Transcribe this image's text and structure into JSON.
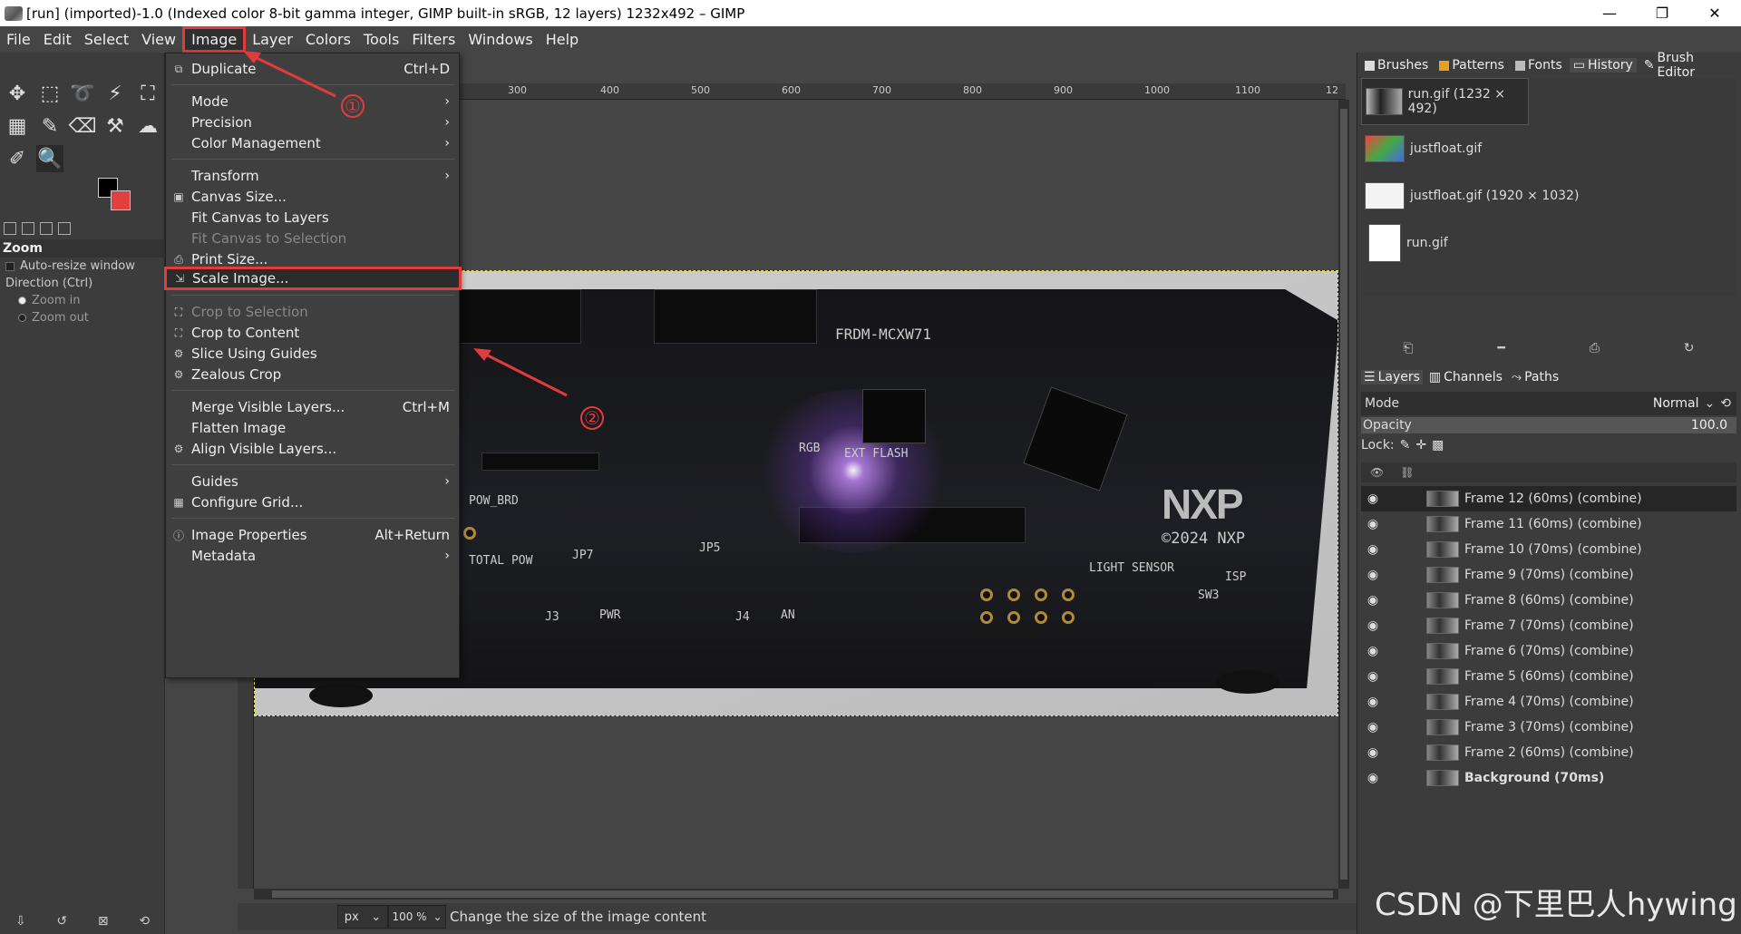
{
  "window": {
    "title": "[run] (imported)-1.0 (Indexed color 8-bit gamma integer, GIMP built-in sRGB, 12 layers) 1232x492 – GIMP",
    "minimize": "—",
    "maximize": "❐",
    "close": "✕"
  },
  "menubar": [
    "File",
    "Edit",
    "Select",
    "View",
    "Image",
    "Layer",
    "Colors",
    "Tools",
    "Filters",
    "Windows",
    "Help"
  ],
  "image_menu": {
    "duplicate": {
      "label": "Duplicate",
      "shortcut": "Ctrl+D"
    },
    "mode": "Mode",
    "precision": "Precision",
    "color_management": "Color Management",
    "transform": "Transform",
    "canvas_size": "Canvas Size...",
    "fit_canvas_layers": "Fit Canvas to Layers",
    "fit_canvas_selection": "Fit Canvas to Selection",
    "print_size": "Print Size...",
    "scale_image": "Scale Image...",
    "crop_selection": "Crop to Selection",
    "crop_content": "Crop to Content",
    "slice_guides": "Slice Using Guides",
    "zealous_crop": "Zealous Crop",
    "merge_visible": {
      "label": "Merge Visible Layers...",
      "shortcut": "Ctrl+M"
    },
    "flatten": "Flatten Image",
    "align_visible": "Align Visible Layers...",
    "guides": "Guides",
    "configure_grid": "Configure Grid...",
    "image_properties": {
      "label": "Image Properties",
      "shortcut": "Alt+Return"
    },
    "metadata": "Metadata"
  },
  "annotations": {
    "step1": "①",
    "step2": "②"
  },
  "tool_options": {
    "title": "Zoom",
    "auto_resize": "Auto-resize window",
    "direction": "Direction  (Ctrl)",
    "zoom_in": "Zoom in",
    "zoom_out": "Zoom out"
  },
  "ruler_marks": [
    "300",
    "400",
    "500",
    "600",
    "700",
    "800",
    "900",
    "1000",
    "1100",
    "12"
  ],
  "pcb_labels": {
    "board_name": "FRDM-MCXW71",
    "logo": "NXP",
    "copyright": "©2024 NXP",
    "rgb": "RGB",
    "ext_flash": "EXT FLASH",
    "light_sensor": "LIGHT SENSOR",
    "pow_brd": "POW_BRD",
    "total_pow": "TOTAL POW",
    "pwr": "PWR",
    "an": "AN",
    "j3": "J3",
    "j4": "J4",
    "jp7": "JP7",
    "jp5": "JP5",
    "sw3": "SW3",
    "isp": "ISP"
  },
  "dock": {
    "tabs": [
      "Brushes",
      "Patterns",
      "Fonts",
      "History",
      "Brush Editor"
    ],
    "images": [
      {
        "name": "run.gif (1232 × 492)"
      },
      {
        "name": "justfloat.gif"
      },
      {
        "name": "justfloat.gif (1920 × 1032)"
      },
      {
        "name": "run.gif"
      }
    ],
    "layers_tabs": [
      "Layers",
      "Channels",
      "Paths"
    ],
    "mode_label": "Mode",
    "mode_value": "Normal",
    "opacity_label": "Opacity",
    "opacity_value": "100.0",
    "lock_label": "Lock:",
    "layers": [
      "Frame 12 (60ms) (combine)",
      "Frame 11 (60ms) (combine)",
      "Frame 10 (70ms) (combine)",
      "Frame 9 (70ms) (combine)",
      "Frame 8 (60ms) (combine)",
      "Frame 7 (70ms) (combine)",
      "Frame 6 (70ms) (combine)",
      "Frame 5 (60ms) (combine)",
      "Frame 4 (70ms) (combine)",
      "Frame 3 (70ms) (combine)",
      "Frame 2 (60ms) (combine)",
      "Background (70ms)"
    ]
  },
  "statusbar": {
    "unit": "px",
    "zoom": "100 %",
    "message": "Change the size of the image content"
  },
  "watermark": "CSDN @下里巴人hywing",
  "colors": {
    "accent_red": "#e23b3b",
    "fg": "#000000",
    "bg": "#e24040"
  }
}
